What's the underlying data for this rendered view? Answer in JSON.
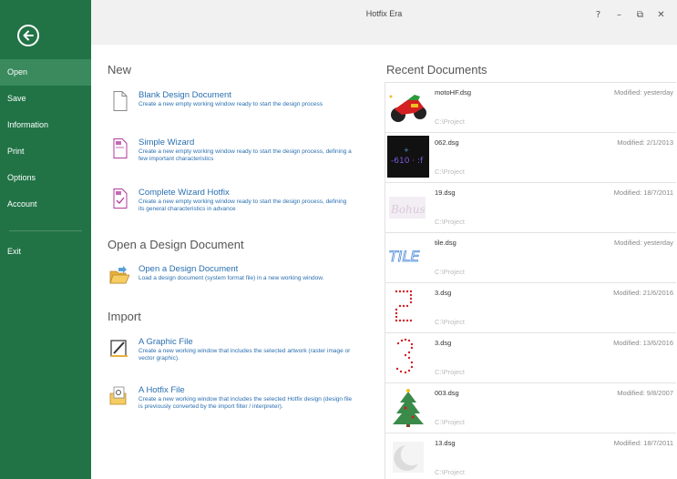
{
  "app": {
    "title": "Hotfix Era"
  },
  "window_controls": {
    "help": "?",
    "minimize": "–",
    "restore": "⧉",
    "close": "✕"
  },
  "sidebar": {
    "items": [
      {
        "label": "Open"
      },
      {
        "label": "Save"
      },
      {
        "label": "Information"
      },
      {
        "label": "Print"
      },
      {
        "label": "Options"
      },
      {
        "label": "Account"
      },
      {
        "label": "Exit"
      }
    ]
  },
  "new_section": {
    "title": "New",
    "items": [
      {
        "title": "Blank Design Document",
        "desc": "Create a new empty working window ready to start the design process"
      },
      {
        "title": "Simple Wizard",
        "desc": "Create a new empty working window ready to start the design process, defining a few important characteristics"
      },
      {
        "title": "Complete Wizard Hotfix",
        "desc": "Create a new empty working window ready to start the design process, defining its general characteristics in advance"
      }
    ]
  },
  "open_section": {
    "title": "Open a Design Document",
    "items": [
      {
        "title": "Open a Design Document",
        "desc": "Load a design document (system format file) in a new working window."
      }
    ]
  },
  "import_section": {
    "title": "Import",
    "items": [
      {
        "title": "A Graphic File",
        "desc": "Create a new working window that includes the selected artwork (raster image or vector graphic)."
      },
      {
        "title": "A Hotfix File",
        "desc": "Create a new working window that includes the selected Hotfix design (design file is previously converted by the import filter / interpreter)."
      }
    ]
  },
  "recent": {
    "title": "Recent Documents",
    "docs": [
      {
        "name": "motoHF.dsg",
        "path": "C:\\Project",
        "modified": "Modified: yesterday"
      },
      {
        "name": "062.dsg",
        "path": "C:\\Project",
        "modified": "Modified: 2/1/2013"
      },
      {
        "name": "19.dsg",
        "path": "C:\\Project",
        "modified": "Modified: 18/7/2011"
      },
      {
        "name": "tile.dsg",
        "path": "C:\\Project",
        "modified": "Modified: yesterday",
        "thumb_text": "TILE"
      },
      {
        "name": "3.dsg",
        "path": "C:\\Project",
        "modified": "Modified: 21/6/2016"
      },
      {
        "name": "3.dsg",
        "path": "C:\\Project",
        "modified": "Modified: 13/6/2016"
      },
      {
        "name": "003.dsg",
        "path": "C:\\Project",
        "modified": "Modified: 9/8/2007"
      },
      {
        "name": "13.dsg",
        "path": "C:\\Project",
        "modified": "Modified: 18/7/2011"
      }
    ]
  },
  "colors": {
    "sidebar": "#217346",
    "sidebar_active": "#3a8a5d",
    "link": "#2a6fb0",
    "titlebar": "#f1f1f1"
  }
}
